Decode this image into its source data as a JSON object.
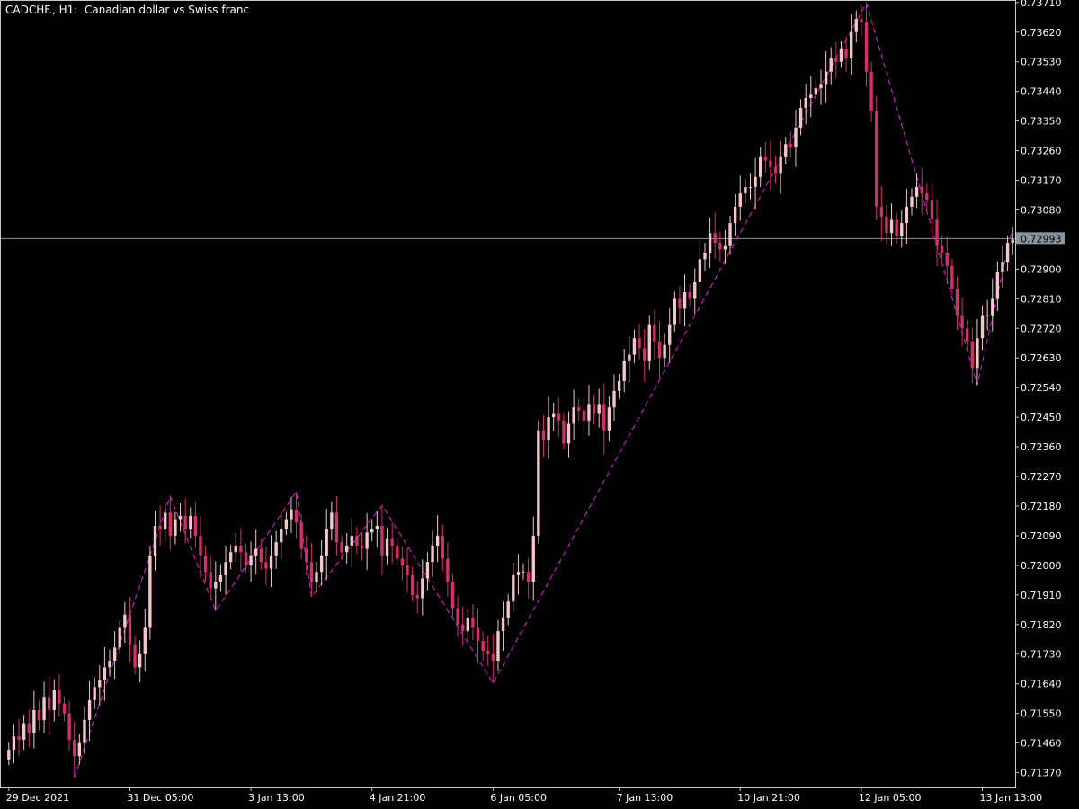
{
  "window": {
    "title": "CADCHF., H1:  Canadian dollar vs Swiss franc"
  },
  "colors": {
    "background": "#000000",
    "frame": "#c8c8c8",
    "axis_text": "#ffffff",
    "bull_candle": "#f3c6c9",
    "bear_candle": "#d3306b",
    "zigzag": "#e020e0",
    "price_line": "#8a94a0",
    "price_tag_bg": "#8a94a0"
  },
  "chart_data": {
    "type": "candlestick",
    "symbol": "CADCHF.",
    "timeframe": "H1",
    "description": "Canadian dollar vs Swiss franc",
    "ylim": [
      0.71325,
      0.73715
    ],
    "y_ticks": [
      "0.73710",
      "0.73620",
      "0.73530",
      "0.73440",
      "0.73350",
      "0.73260",
      "0.73170",
      "0.73080",
      "0.72900",
      "0.72810",
      "0.72720",
      "0.72630",
      "0.72540",
      "0.72450",
      "0.72360",
      "0.72270",
      "0.72180",
      "0.72090",
      "0.72000",
      "0.71910",
      "0.71820",
      "0.71730",
      "0.71640",
      "0.71550",
      "0.71460",
      "0.71370"
    ],
    "x_ticks": [
      "29 Dec 2021",
      "31 Dec 05:00",
      "3 Jan 13:00",
      "4 Jan 21:00",
      "6 Jan 05:00",
      "7 Jan 13:00",
      "10 Jan 21:00",
      "12 Jan 05:00",
      "13 Jan 13:00"
    ],
    "current_price": "0.72993",
    "close_series": [
      0.7144,
      0.7148,
      0.7147,
      0.7152,
      0.7149,
      0.7156,
      0.7153,
      0.716,
      0.7156,
      0.7162,
      0.7158,
      0.7155,
      0.7147,
      0.7142,
      0.7146,
      0.7153,
      0.7159,
      0.7163,
      0.7165,
      0.7169,
      0.7171,
      0.7175,
      0.7181,
      0.7185,
      0.7176,
      0.7169,
      0.7173,
      0.7181,
      0.7203,
      0.7212,
      0.7211,
      0.7216,
      0.7209,
      0.7214,
      0.7215,
      0.7211,
      0.7215,
      0.7209,
      0.7203,
      0.7198,
      0.7193,
      0.7195,
      0.7197,
      0.7201,
      0.7204,
      0.7206,
      0.7204,
      0.72,
      0.7203,
      0.7205,
      0.7201,
      0.7199,
      0.7203,
      0.7207,
      0.7211,
      0.7214,
      0.7217,
      0.7213,
      0.7205,
      0.7201,
      0.7195,
      0.7198,
      0.7203,
      0.7211,
      0.7216,
      0.7207,
      0.7204,
      0.7206,
      0.7209,
      0.7206,
      0.7205,
      0.721,
      0.7211,
      0.7212,
      0.7203,
      0.7208,
      0.7206,
      0.7202,
      0.72,
      0.7197,
      0.7191,
      0.719,
      0.7196,
      0.7201,
      0.7206,
      0.7209,
      0.7202,
      0.7195,
      0.7187,
      0.7182,
      0.718,
      0.7184,
      0.7181,
      0.7177,
      0.7174,
      0.7173,
      0.7171,
      0.718,
      0.7184,
      0.7189,
      0.7197,
      0.7198,
      0.7198,
      0.7195,
      0.7209,
      0.7241,
      0.7238,
      0.7245,
      0.7246,
      0.7244,
      0.7237,
      0.7243,
      0.7248,
      0.7247,
      0.7244,
      0.7249,
      0.7246,
      0.7249,
      0.7241,
      0.7248,
      0.7253,
      0.7256,
      0.7262,
      0.7264,
      0.7269,
      0.7266,
      0.7262,
      0.7273,
      0.7268,
      0.7263,
      0.7267,
      0.7273,
      0.7281,
      0.7278,
      0.7283,
      0.7281,
      0.7286,
      0.7293,
      0.7295,
      0.7301,
      0.7298,
      0.7296,
      0.7297,
      0.7304,
      0.7309,
      0.7313,
      0.7315,
      0.7315,
      0.7318,
      0.7324,
      0.7323,
      0.7321,
      0.7319,
      0.7324,
      0.7328,
      0.7327,
      0.7333,
      0.7339,
      0.7342,
      0.7343,
      0.7345,
      0.7346,
      0.735,
      0.7354,
      0.7353,
      0.7357,
      0.7354,
      0.7362,
      0.7366,
      0.7365,
      0.735,
      0.7338,
      0.7309,
      0.7306,
      0.7301,
      0.7305,
      0.73,
      0.7304,
      0.7309,
      0.7312,
      0.7315,
      0.7313,
      0.7311,
      0.7305,
      0.7297,
      0.7295,
      0.7291,
      0.7284,
      0.7276,
      0.7272,
      0.7268,
      0.726,
      0.7269,
      0.7276,
      0.7276,
      0.7281,
      0.7289,
      0.7292,
      0.7298,
      0.7299
    ]
  }
}
